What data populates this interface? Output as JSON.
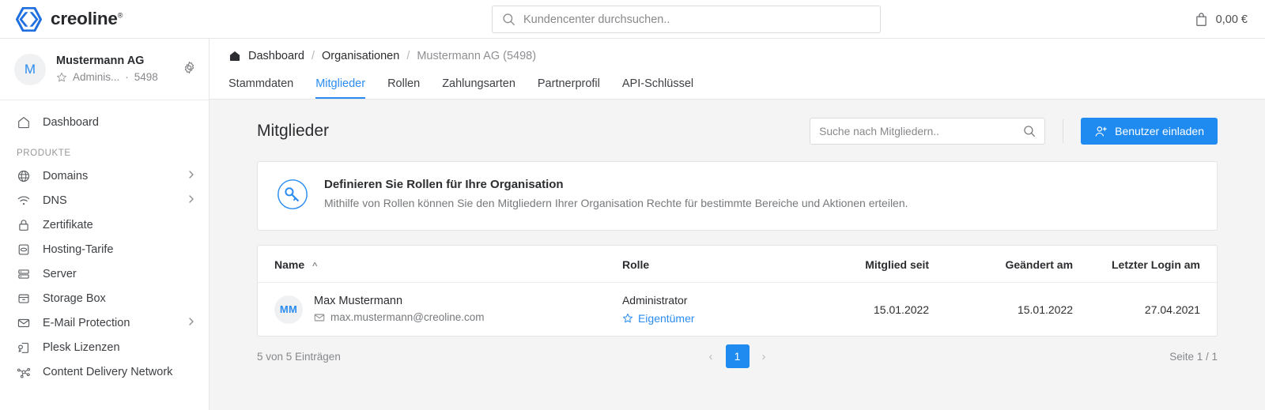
{
  "topbar": {
    "brand_name": "creoline",
    "brand_mark": "®",
    "search_placeholder": "Kundencenter durchsuchen..",
    "search_value": "",
    "cart_amount": "0,00 €",
    "search_icon": "search-icon",
    "cart_icon": "shopping-bag-icon"
  },
  "sidebar": {
    "org": {
      "avatar_initial": "M",
      "name": "Mustermann AG",
      "role": "Adminis...",
      "separator": "·",
      "id": "5498",
      "star_icon": "star-icon",
      "gear_icon": "gear-icon"
    },
    "top_items": [
      {
        "label": "Dashboard",
        "icon": "home-icon",
        "chevron": false
      }
    ],
    "section_label": "PRODUKTE",
    "items": [
      {
        "label": "Domains",
        "icon": "globe-icon",
        "chevron": true
      },
      {
        "label": "DNS",
        "icon": "wifi-icon",
        "chevron": true
      },
      {
        "label": "Zertifikate",
        "icon": "lock-icon",
        "chevron": false
      },
      {
        "label": "Hosting-Tarife",
        "icon": "database-icon",
        "chevron": false
      },
      {
        "label": "Server",
        "icon": "server-icon",
        "chevron": false
      },
      {
        "label": "Storage Box",
        "icon": "box-icon",
        "chevron": false
      },
      {
        "label": "E-Mail Protection",
        "icon": "mail-icon",
        "chevron": true
      },
      {
        "label": "Plesk Lizenzen",
        "icon": "plesk-icon",
        "chevron": false
      },
      {
        "label": "Content Delivery Network",
        "icon": "network-icon",
        "chevron": false
      }
    ]
  },
  "breadcrumb": {
    "home_icon": "home-icon",
    "items": [
      {
        "label": "Dashboard",
        "current": false
      },
      {
        "label": "Organisationen",
        "current": false
      },
      {
        "label": "Mustermann AG (5498)",
        "current": true
      }
    ],
    "separator": "/"
  },
  "tabs": [
    {
      "label": "Stammdaten",
      "active": false
    },
    {
      "label": "Mitglieder",
      "active": true
    },
    {
      "label": "Rollen",
      "active": false
    },
    {
      "label": "Zahlungsarten",
      "active": false
    },
    {
      "label": "Partnerprofil",
      "active": false
    },
    {
      "label": "API-Schlüssel",
      "active": false
    }
  ],
  "page": {
    "title": "Mitglieder",
    "search_placeholder": "Suche nach Mitgliedern..",
    "search_value": "",
    "search_icon": "search-icon",
    "invite_button": "Benutzer einladen",
    "invite_icon": "user-plus-icon"
  },
  "banner": {
    "icon": "key-icon",
    "title": "Definieren Sie Rollen für Ihre Organisation",
    "text": "Mithilfe von Rollen können Sie den Mitgliedern Ihrer Organisation Rechte für bestimmte Bereiche und Aktionen erteilen."
  },
  "table": {
    "columns": [
      {
        "label": "Name",
        "sort_icon": "chevron-up-icon"
      },
      {
        "label": "Rolle"
      },
      {
        "label": "Mitglied seit"
      },
      {
        "label": "Geändert am"
      },
      {
        "label": "Letzter Login am"
      }
    ],
    "rows": [
      {
        "avatar_initials": "MM",
        "name": "Max Mustermann",
        "email": "max.mustermann@creoline.com",
        "mail_icon": "envelope-icon",
        "role": "Administrator",
        "owner_label": "Eigentümer",
        "owner_icon": "star-icon",
        "member_since": "15.01.2022",
        "changed_at": "15.01.2022",
        "last_login": "27.04.2021"
      }
    ]
  },
  "pagination": {
    "entries_text": "5 von 5 Einträgen",
    "prev_icon": "chevron-left-icon",
    "next_icon": "chevron-right-icon",
    "current_page": "1",
    "page_info": "Seite 1 / 1"
  },
  "colors": {
    "accent": "#1f8bf0",
    "link": "#2a8cf0",
    "text": "#2b2d30",
    "muted": "#86888b",
    "bg": "#f4f4f4",
    "border": "#e4e4e4"
  }
}
